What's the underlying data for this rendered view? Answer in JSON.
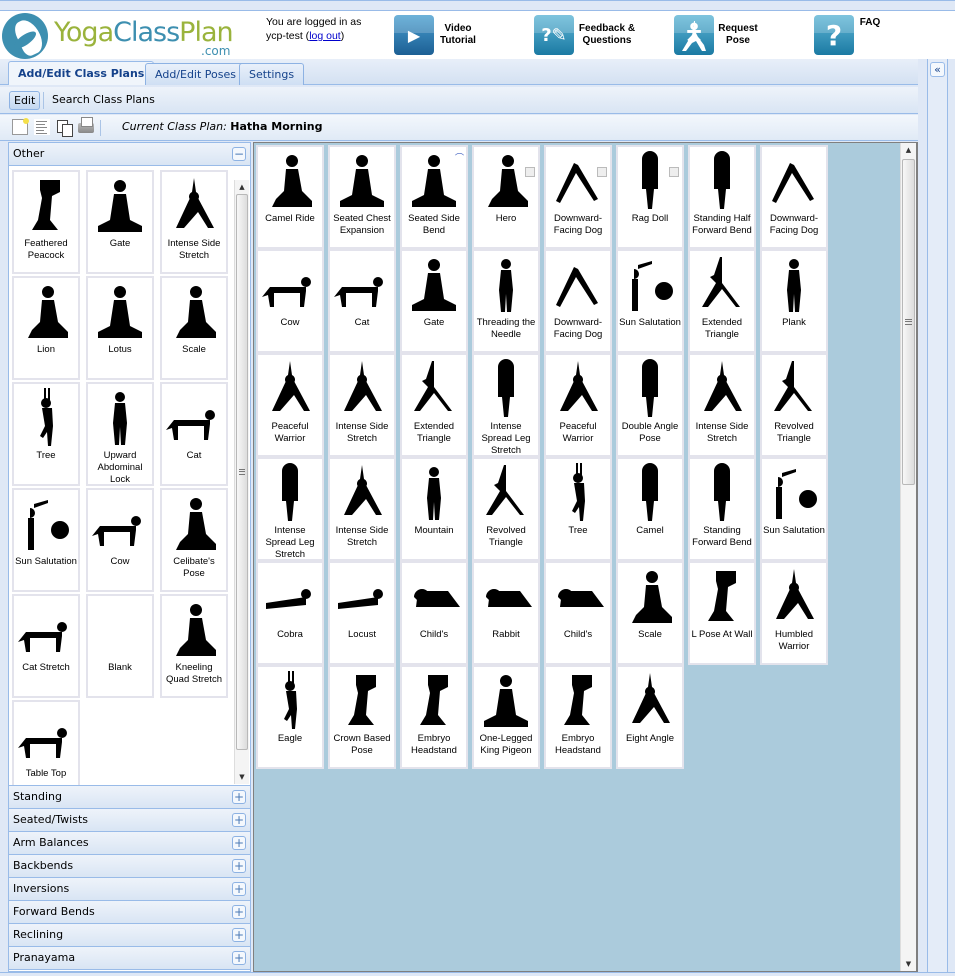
{
  "header": {
    "logo_text_a": "Yoga",
    "logo_text_b": "Class",
    "logo_text_c": "Plan",
    "logo_suffix": ".com",
    "login_prefix": "You are logged in as ycp-test (",
    "logout_label": "log out",
    "login_suffix": ")",
    "buttons": [
      {
        "icon": "video-tutorial-icon",
        "label": "Video Tutorial"
      },
      {
        "icon": "feedback-icon",
        "label": "Feedback & Questions"
      },
      {
        "icon": "request-pose-icon",
        "label": "Request Pose"
      },
      {
        "icon": "faq-icon",
        "label": "FAQ"
      }
    ]
  },
  "tabs": [
    {
      "label": "Add/Edit Class Plans",
      "active": true
    },
    {
      "label": "Add/Edit Poses",
      "active": false
    },
    {
      "label": "Settings",
      "active": false
    }
  ],
  "subnav": [
    {
      "label": "Edit",
      "active": true
    },
    {
      "label": "Search Class Plans",
      "active": false
    }
  ],
  "toolbar": {
    "icons": [
      "new-plan-icon",
      "list-icon",
      "copy-icon",
      "print-icon"
    ],
    "current_label": "Current Class Plan:",
    "current_value": "Hatha Morning"
  },
  "sidebar": {
    "open_section": "Other",
    "collapse_symbol": "−",
    "expand_symbol": "+",
    "other_poses": [
      "Feathered Peacock",
      "Gate",
      "Intense Side Stretch",
      "Lion",
      "Lotus",
      "Scale",
      "Tree",
      "Upward Abdominal Lock",
      "Cat",
      "Sun Salutation",
      "Cow",
      "Celibate's Pose",
      "Cat Stretch",
      "Blank",
      "Kneeling Quad Stretch",
      "Table Top"
    ],
    "sections": [
      "Standing",
      "Seated/Twists",
      "Arm Balances",
      "Backbends",
      "Inversions",
      "Forward Bends",
      "Reclining",
      "Pranayama"
    ]
  },
  "class_plan": {
    "poses": [
      "Camel Ride",
      "Seated Chest Expansion",
      "Seated Side Bend",
      "Hero",
      "Downward-Facing Dog",
      "Rag Doll",
      "Standing Half Forward Bend",
      "Downward-Facing Dog",
      "Cow",
      "Cat",
      "Gate",
      "Threading the Needle",
      "Downward-Facing Dog",
      "Sun Salutation",
      "Extended Triangle",
      "Plank",
      "Peaceful Warrior",
      "Intense Side Stretch",
      "Extended Triangle",
      "Intense Spread Leg Stretch",
      "Peaceful Warrior",
      "Double Angle Pose",
      "Intense Side Stretch",
      "Revolved Triangle",
      "Intense Spread Leg Stretch",
      "Intense Side Stretch",
      "Mountain",
      "Revolved Triangle",
      "Tree",
      "Camel",
      "Standing Forward Bend",
      "Sun Salutation",
      "Cobra",
      "Locust",
      "Child's",
      "Rabbit",
      "Child's",
      "Scale",
      "L Pose At Wall",
      "Humbled Warrior",
      "Eagle",
      "Crown Based Pose",
      "Embryo Headstand",
      "One-Legged King Pigeon",
      "Embryo Headstand",
      "Eight Angle"
    ],
    "noted_pose_indices": [
      3,
      4,
      5
    ],
    "clip_pose_index": 2
  },
  "scroll": {
    "up_symbol": "▲",
    "down_symbol": "▼",
    "collapse_panel_symbol": "«"
  }
}
